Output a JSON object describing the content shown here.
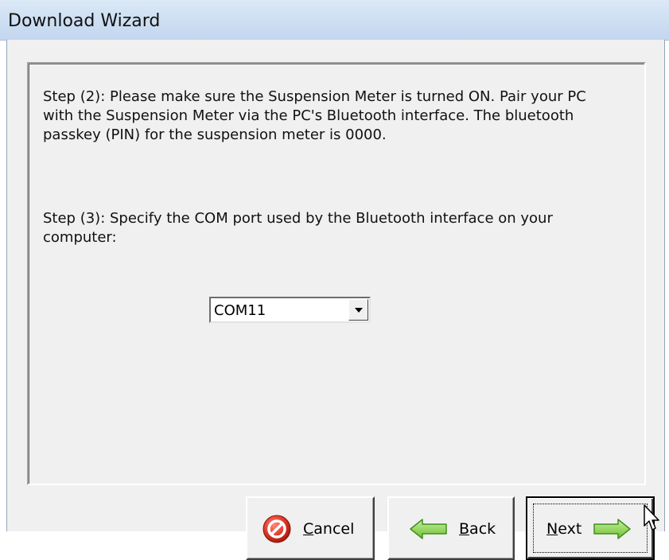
{
  "window": {
    "title": "Download Wizard"
  },
  "steps": {
    "step2": "Step (2): Please make sure the Suspension Meter is turned ON. Pair your PC with the Suspension Meter via the PC's Bluetooth interface. The bluetooth passkey (PIN) for the suspension meter is 0000.",
    "step3": "Step (3): Specify the COM port used by the Bluetooth interface on your computer:"
  },
  "com_port": {
    "selected": "COM11"
  },
  "buttons": {
    "cancel_label": "Cancel",
    "back_label": "Back",
    "next_label": "Next",
    "cancel_accel": "C",
    "cancel_rest": "ancel",
    "back_accel": "B",
    "back_rest": "ack",
    "next_accel": "N",
    "next_rest": "ext"
  },
  "icons": {
    "cancel": "cancel-icon",
    "back": "arrow-left-icon",
    "next": "arrow-right-icon",
    "dropdown": "chevron-down-icon",
    "cursor": "mouse-cursor-icon"
  },
  "colors": {
    "cancel_red": "#e03a2a",
    "arrow_green": "#7ad23b",
    "arrow_green_dark": "#3f8f1d"
  }
}
